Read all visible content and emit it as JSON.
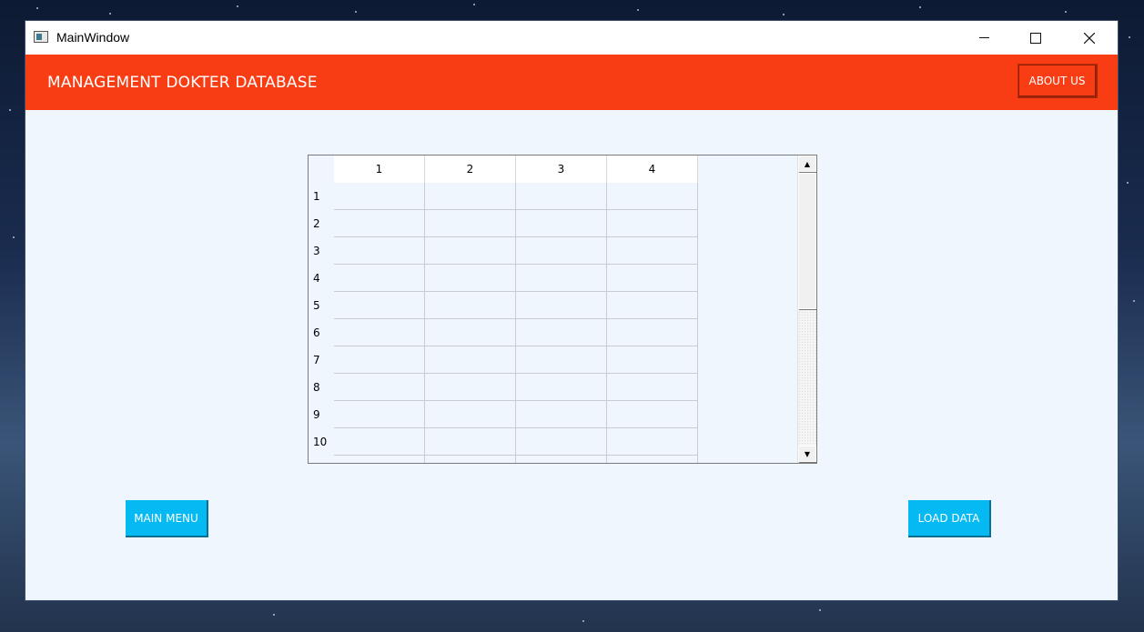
{
  "window": {
    "title": "MainWindow",
    "controls": {
      "minimize": "minimize-icon",
      "maximize": "maximize-icon",
      "close": "close-icon"
    }
  },
  "header": {
    "title": "MANAGEMENT DOKTER DATABASE",
    "about_label": "ABOUT US",
    "color": "#f83d15"
  },
  "table": {
    "columns": [
      "1",
      "2",
      "3",
      "4"
    ],
    "rows": [
      "1",
      "2",
      "3",
      "4",
      "5",
      "6",
      "7",
      "8",
      "9",
      "10"
    ]
  },
  "buttons": {
    "main_menu": "MAIN MENU",
    "load_data": "LOAD DATA",
    "color": "#05b9f2"
  }
}
